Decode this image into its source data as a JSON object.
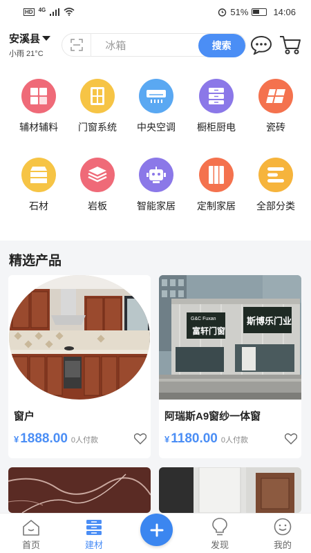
{
  "status_bar": {
    "hd": "HD",
    "network": "4G",
    "battery_text": "51%",
    "battery_level": 0.51,
    "time": "14:06"
  },
  "header": {
    "city": "安溪县",
    "weather": "小雨 21°C",
    "search_placeholder": "冰箱",
    "search_button": "搜索"
  },
  "categories": [
    {
      "label": "辅材辅料",
      "color": "#ef6a78",
      "icon": "grid-icon"
    },
    {
      "label": "门窗系统",
      "color": "#f6c445",
      "icon": "window-icon"
    },
    {
      "label": "中央空调",
      "color": "#5aa8f2",
      "icon": "air-conditioner-icon"
    },
    {
      "label": "橱柜厨电",
      "color": "#8b78e8",
      "icon": "cabinet-icon"
    },
    {
      "label": "瓷砖",
      "color": "#f4724e",
      "icon": "tile-icon"
    },
    {
      "label": "石材",
      "color": "#f6c445",
      "icon": "stone-icon"
    },
    {
      "label": "岩板",
      "color": "#ef6a78",
      "icon": "slab-icon"
    },
    {
      "label": "智能家居",
      "color": "#8b78e8",
      "icon": "robot-icon"
    },
    {
      "label": "定制家居",
      "color": "#f4724e",
      "icon": "wardrobe-icon"
    },
    {
      "label": "全部分类",
      "color": "#f6b43c",
      "icon": "list-icon"
    }
  ],
  "section": {
    "title": "精选产品"
  },
  "products": [
    {
      "name": "窗户",
      "currency": "¥",
      "price": "1888.00",
      "paid": "0人付款"
    },
    {
      "name": "阿瑞斯A9窗纱一体窗",
      "currency": "¥",
      "price": "1180.00",
      "paid": "0人付款"
    }
  ],
  "store_sign": {
    "left": "富轩门窗",
    "left_small": "G&C Fuxan",
    "right": "斯博乐门业"
  },
  "tabs": [
    {
      "label": "首页",
      "icon": "home-icon"
    },
    {
      "label": "建材",
      "icon": "building-materials-icon"
    },
    {
      "label": "发现",
      "icon": "lightbulb-icon"
    },
    {
      "label": "我的",
      "icon": "smiley-face-icon"
    }
  ],
  "colors": {
    "accent": "#4b8ef5",
    "price": "#4b8ef5"
  }
}
